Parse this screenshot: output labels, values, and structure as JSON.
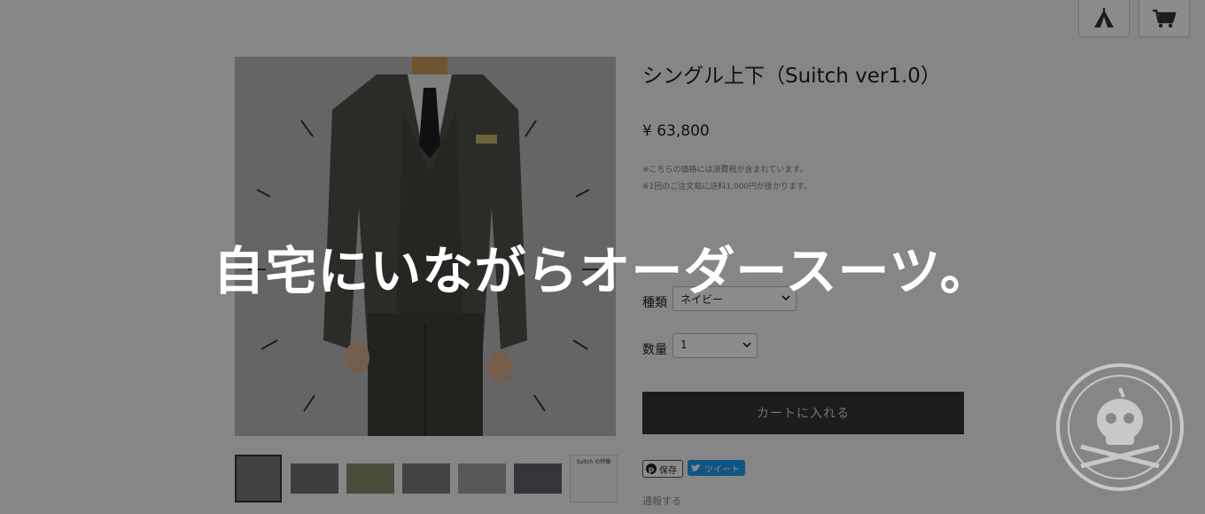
{
  "header": {
    "nav_home_icon": "tent-icon",
    "nav_cart_icon": "cart-icon"
  },
  "product": {
    "title": "シングル上下（Suitch ver1.0）",
    "price": "¥ 63,800",
    "notes": [
      "※こちらの価格には消費税が含まれています。",
      "※1回のご注文毎に送料1,000円が掛かります。"
    ],
    "options": [
      {
        "label": "種類",
        "selected": "ネイビー"
      },
      {
        "label": "数量",
        "selected": "1"
      }
    ],
    "add_to_cart": "カートに入れる",
    "share": {
      "pinterest": "保存",
      "twitter": "ツイート"
    },
    "report": "通報する"
  },
  "gallery": {
    "thumb_last_caption": "Suitch の特徴"
  },
  "overlay": {
    "headline": "自宅にいながらオーダースーツ。"
  },
  "colors": {
    "overlay": "#000000",
    "cart_button": "#333333",
    "twitter": "#1d9bf0"
  }
}
